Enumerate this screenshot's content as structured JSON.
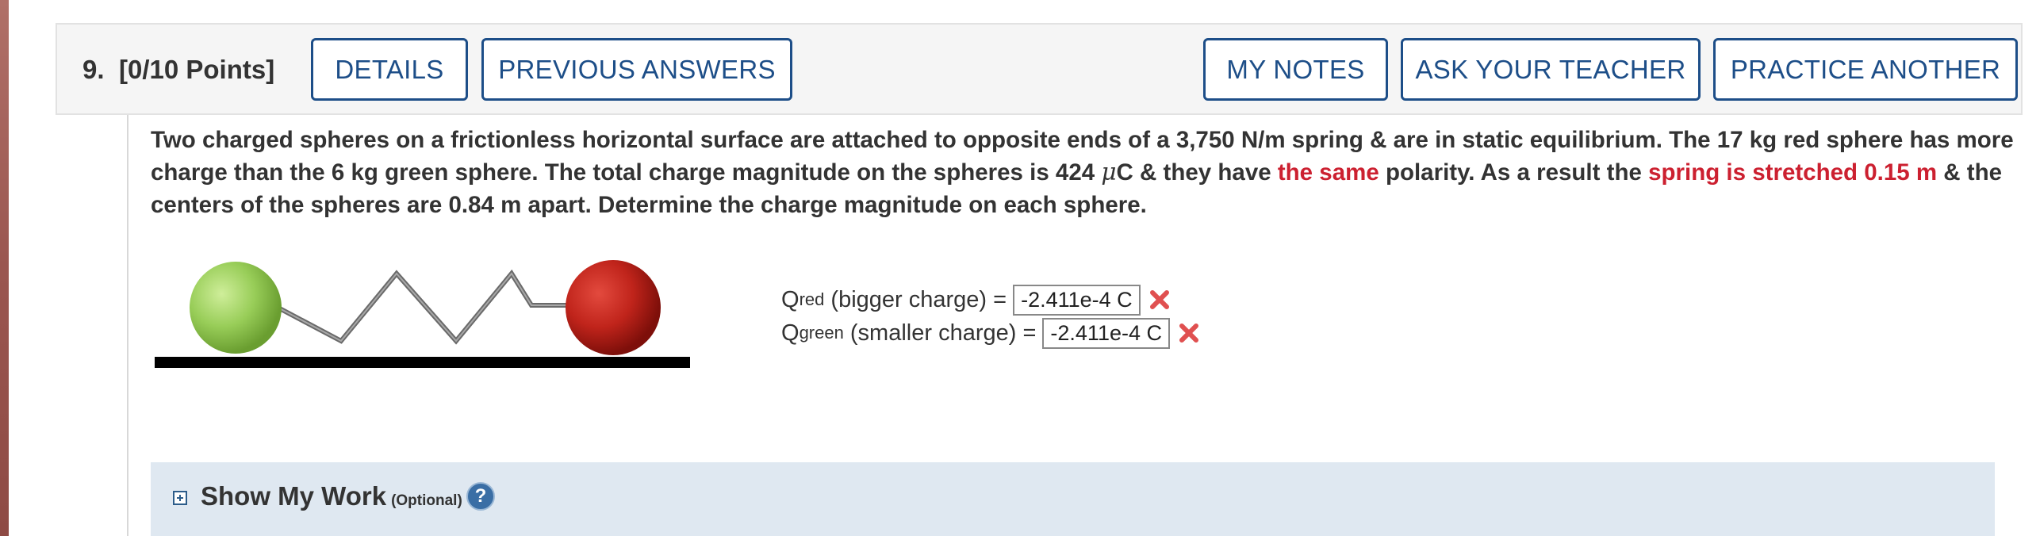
{
  "question": {
    "number": "9.",
    "points": "[0/10 Points]",
    "buttons": {
      "details": "DETAILS",
      "previous_answers": "PREVIOUS ANSWERS",
      "my_notes": "MY NOTES",
      "ask_teacher": "ASK YOUR TEACHER",
      "practice_another": "PRACTICE ANOTHER"
    }
  },
  "problem": {
    "seg1": "Two charged spheres on a frictionless horizontal surface are attached to opposite ends of a 3,750 N/m spring & are in static equilibrium. The 17 kg red sphere has more charge than the 6 kg green sphere. The total charge magnitude on the spheres is 424 ",
    "mu": "μ",
    "seg2": "C & they have ",
    "red1": "the same",
    "seg3": " polarity. As a result the ",
    "red2": "spring is stretched 0.15 m",
    "seg4": " & the centers of the spheres are 0.84 m apart. Determine the charge magnitude on each sphere."
  },
  "answers": [
    {
      "q_symbol": "Q",
      "subscript": "red",
      "label": " (bigger charge) =",
      "value": "-2.411e-4 C",
      "status_icon": "incorrect-x-icon"
    },
    {
      "q_symbol": "Q",
      "subscript": "green",
      "label": " (smaller charge) =",
      "value": "-2.411e-4 C",
      "status_icon": "incorrect-x-icon"
    }
  ],
  "show_work": {
    "title": "Show My Work",
    "optional": "(Optional)",
    "help": "?"
  },
  "colors": {
    "accent": "#1d4e88",
    "incorrect": "#cc2030",
    "work_bar": "#dfe8f1"
  }
}
